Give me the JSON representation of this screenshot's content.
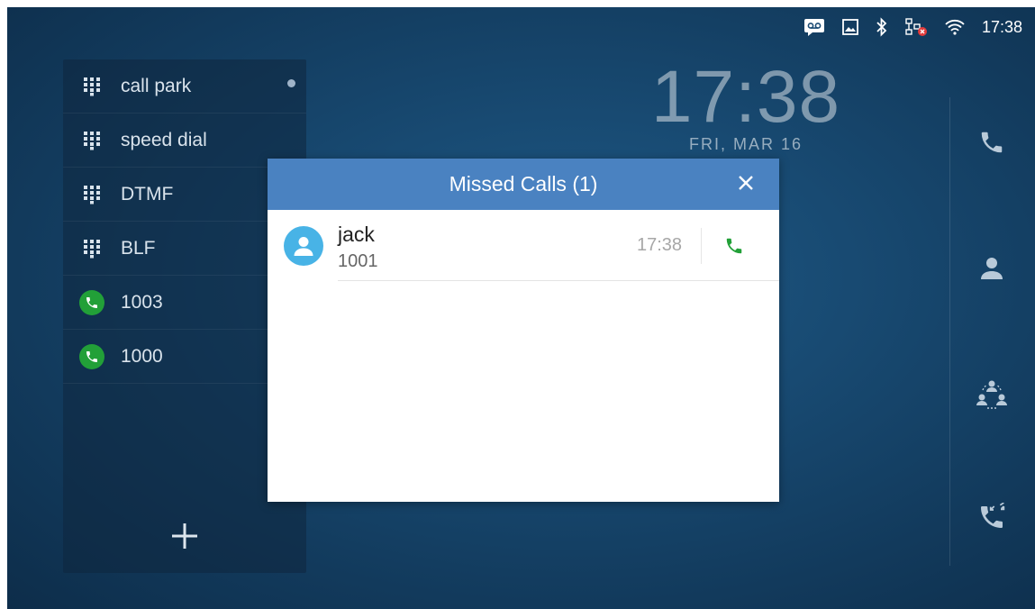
{
  "status_bar": {
    "icons": [
      "voicemail-icon",
      "screenshot-icon",
      "bluetooth-icon",
      "network-disconnected-icon",
      "wifi-icon"
    ],
    "time": "17:38"
  },
  "side_panel": {
    "items": [
      {
        "label": "call park",
        "icon": "dialpad-icon"
      },
      {
        "label": "speed dial",
        "icon": "dialpad-icon"
      },
      {
        "label": "DTMF",
        "icon": "dialpad-icon"
      },
      {
        "label": "BLF",
        "icon": "dialpad-icon"
      },
      {
        "label": "1003",
        "icon": "phone-icon"
      },
      {
        "label": "1000",
        "icon": "phone-icon"
      }
    ],
    "add_icon": "plus-icon"
  },
  "clock": {
    "time": "17:38",
    "date": "FRI, MAR 16"
  },
  "right_dock": {
    "icons": [
      "phone-icon",
      "contacts-icon",
      "conference-icon",
      "call-history-icon"
    ]
  },
  "dialog": {
    "title": "Missed Calls (1)",
    "close_icon": "close-icon",
    "calls": [
      {
        "name": "jack",
        "number": "1001",
        "time": "17:38"
      }
    ]
  },
  "colors": {
    "dialog_header": "#4a82c1",
    "accent_green": "#22a038",
    "avatar_blue": "#48b3e6"
  }
}
